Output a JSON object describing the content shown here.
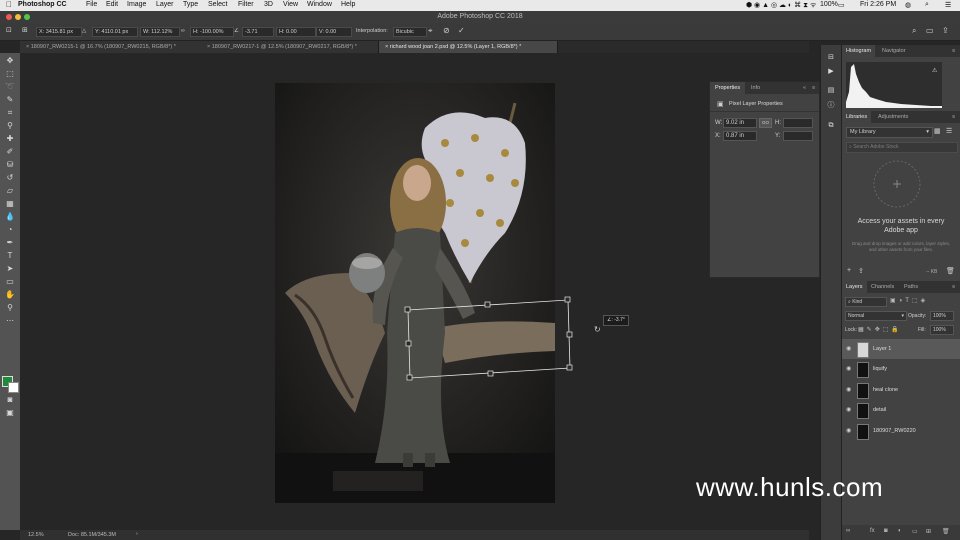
{
  "menubar": {
    "app": "Photoshop CC",
    "items": [
      "File",
      "Edit",
      "Image",
      "Layer",
      "Type",
      "Select",
      "Filter",
      "3D",
      "View",
      "Window",
      "Help"
    ],
    "battery": "100%",
    "clock": "Fri 2:26 PM"
  },
  "window": {
    "title": "Adobe Photoshop CC 2018"
  },
  "options": {
    "x": "X: 3415.81 px",
    "y": "Y: 4110.01 px",
    "w": "W: 112.12%",
    "h": "H: -100.00%",
    "angle": "-3.71",
    "hskew": "H: 0.00",
    "vskew": "V: 0.00",
    "interp_label": "Interpolation:",
    "interp_value": "Bicubic"
  },
  "tabs": [
    {
      "label": "180907_RW0215-1 @ 16.7% (180907_RW0215, RGB/8*) *"
    },
    {
      "label": "180907_RW0217-1 @ 12.5% (180907_RW0217, RGB/8*) *"
    },
    {
      "label": "richard wood joan 2.psd @ 12.5% (Layer 1, RGB/8*) *"
    }
  ],
  "canvas": {
    "rotate_readout": "∠: -3.7°"
  },
  "status": {
    "zoom": "12.5%",
    "doc": "Doc: 85.1M/345.3M"
  },
  "properties": {
    "tabs": [
      "Properties",
      "Info"
    ],
    "section": "Pixel Layer Properties",
    "w_label": "W:",
    "w_value": "9.02 in",
    "h_label": "H:",
    "x_label": "X:",
    "x_value": "0.87 in",
    "y_label": "Y:",
    "link": "GO"
  },
  "histogram": {
    "tabs": [
      "Histogram",
      "Navigator"
    ]
  },
  "libraries": {
    "tabs": [
      "Libraries",
      "Adjustments"
    ],
    "dropdown": "My Library",
    "search_placeholder": "Search Adobe Stock",
    "headline": "Access your assets in every Adobe app",
    "body": "Drag and drop images or add colors, layer styles, and other assets from your files.",
    "size": "-- KB"
  },
  "layers": {
    "tabs": [
      "Layers",
      "Channels",
      "Paths"
    ],
    "kind": "Kind",
    "blend": "Normal",
    "opacity_label": "Opacity:",
    "opacity": "100%",
    "lock_label": "Lock:",
    "fill_label": "Fill:",
    "fill": "100%",
    "items": [
      {
        "name": "Layer 1"
      },
      {
        "name": "liquify"
      },
      {
        "name": "heal clone"
      },
      {
        "name": "detail"
      },
      {
        "name": "180907_RW0220"
      }
    ]
  },
  "watermark": "www.hunls.com",
  "colors": {
    "foreground": "#1f8a3a",
    "background": "#ffffff",
    "accent": "#2d8ceb"
  }
}
